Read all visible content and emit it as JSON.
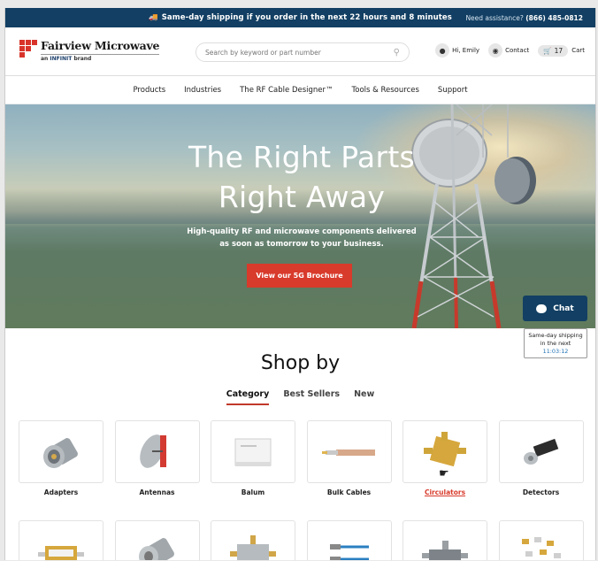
{
  "topbar": {
    "shipping_message": "Same-day shipping if you order in the next 22 hours and 8 minutes",
    "assist_label": "Need assistance?",
    "phone": "(866) 485-0812"
  },
  "header": {
    "logo_text": "Fairview Microwave",
    "logo_tagline_prefix": "an",
    "logo_tagline_brand": "INFINIT",
    "logo_tagline_suffix": "brand",
    "search_placeholder": "Search by keyword or part number",
    "user_label": "Hi, Emily",
    "contact_label": "Contact",
    "cart_count": "17",
    "cart_label": "Cart"
  },
  "nav": {
    "items": [
      "Products",
      "Industries",
      "The RF Cable Designer™",
      "Tools & Resources",
      "Support"
    ]
  },
  "hero": {
    "headline_line1": "The Right Parts",
    "headline_line2": "Right Away",
    "subtext_line1": "High-quality RF and microwave components delivered",
    "subtext_line2": "as soon as tomorrow to your business.",
    "cta_label": "View our 5G Brochure"
  },
  "chat": {
    "label": "Chat",
    "tooltip_line1": "Same-day shipping",
    "tooltip_line2": "in the next",
    "tooltip_time": "11:03:12"
  },
  "shop": {
    "title": "Shop by",
    "tabs": [
      "Category",
      "Best Sellers",
      "New"
    ],
    "active_tab": "Category",
    "categories": [
      "Adapters",
      "Antennas",
      "Balum",
      "Bulk Cables",
      "Circulators",
      "Detectors"
    ]
  },
  "colors": {
    "navy": "#123f63",
    "red": "#d83a2b"
  }
}
